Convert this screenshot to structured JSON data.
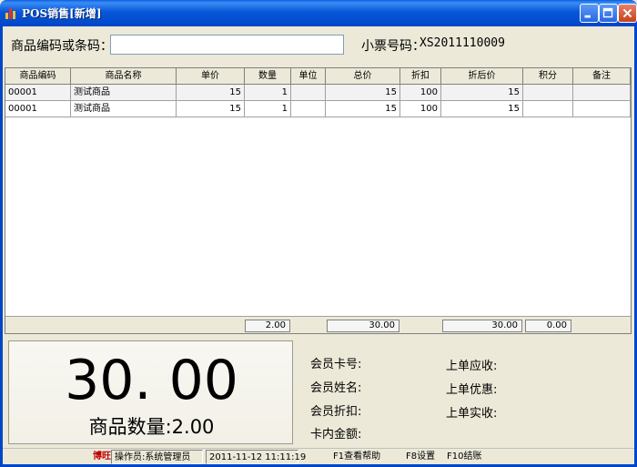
{
  "window": {
    "title": "POS销售[新增]"
  },
  "search": {
    "code_label": "商品编码或条码：",
    "code_value": "",
    "ticket_label": "小票号码：",
    "ticket_no": "XS2011110009"
  },
  "grid": {
    "columns": [
      "商品编码",
      "商品名称",
      "单价",
      "数量",
      "单位",
      "总价",
      "折扣",
      "折后价",
      "积分",
      "备注"
    ],
    "rows": [
      {
        "code": "00001",
        "name": "测试商品",
        "price": "15",
        "qty": "1",
        "unit": "",
        "total": "15",
        "discount": "100",
        "final": "15",
        "points": "",
        "note": ""
      },
      {
        "code": "00001",
        "name": "测试商品",
        "price": "15",
        "qty": "1",
        "unit": "",
        "total": "15",
        "discount": "100",
        "final": "15",
        "points": "",
        "note": ""
      }
    ],
    "summary": {
      "qty": "2.00",
      "total": "30.00",
      "final": "30.00",
      "points": "0.00"
    }
  },
  "totals": {
    "amount": "30. 00",
    "qty_text": "商品数量:2.00"
  },
  "member": {
    "card_label": "会员卡号:",
    "name_label": "会员姓名:",
    "discount_label": "会员折扣:",
    "balance_label": "卡内金额:"
  },
  "last_order": {
    "receivable_label": "上单应收:",
    "discount_label": "上单优惠:",
    "paid_label": "上单实收:"
  },
  "status": {
    "brand": "博旺",
    "operator": "操作员:系统管理员",
    "datetime": "2011-11-12 11:11:19",
    "help": "F1查看帮助",
    "settings": "F8设置",
    "checkout": "F10结账"
  },
  "colors": {
    "titlebar": "#0757d8",
    "close_button": "#c6421d",
    "brand_text": "#c00000",
    "background": "#ece9d8"
  },
  "icons": [
    "app-chart-icon",
    "minimize-icon",
    "maximize-icon",
    "close-icon"
  ]
}
